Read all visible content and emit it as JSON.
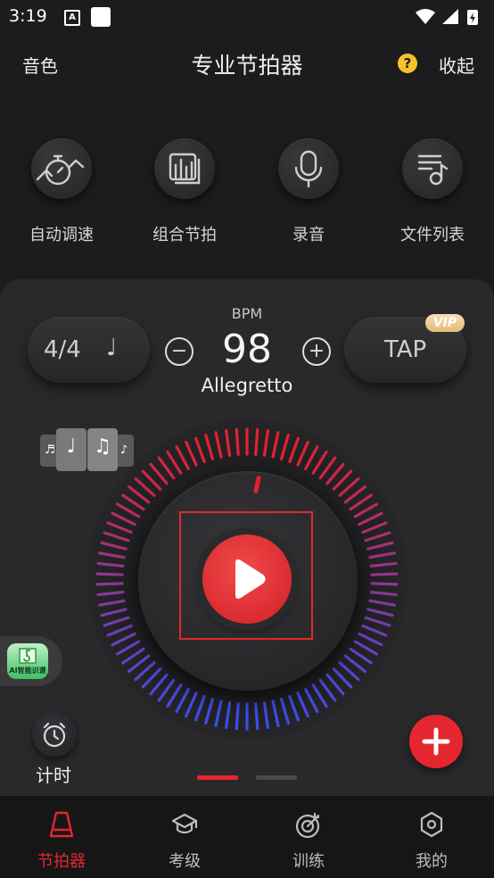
{
  "status_bar": {
    "time": "3:19"
  },
  "top_bar": {
    "left": "音色",
    "title": "专业节拍器",
    "help": "?",
    "right": "收起"
  },
  "tools": [
    {
      "label": "自动调速",
      "icon": "auto-speed-icon"
    },
    {
      "label": "组合节拍",
      "icon": "combo-beat-icon"
    },
    {
      "label": "录音",
      "icon": "microphone-icon"
    },
    {
      "label": "文件列表",
      "icon": "file-list-icon"
    }
  ],
  "metronome": {
    "time_signature": "4/4",
    "note_symbol": "♩",
    "bpm_label": "BPM",
    "bpm": "98",
    "tempo_name": "Allegretto",
    "tap_label": "TAP",
    "vip_label": "VIP",
    "minus": "−",
    "plus": "+"
  },
  "ai_badge": {
    "text": "AI智能识谱"
  },
  "timer": {
    "label": "计时"
  },
  "colors": {
    "accent": "#e5262f",
    "ring_top": "#e5202e",
    "ring_bottom": "#3a4cf0"
  },
  "bottom_nav": [
    {
      "label": "节拍器",
      "icon": "metronome-icon",
      "active": true
    },
    {
      "label": "考级",
      "icon": "graduation-cap-icon",
      "active": false
    },
    {
      "label": "训练",
      "icon": "target-icon",
      "active": false
    },
    {
      "label": "我的",
      "icon": "profile-hexagon-icon",
      "active": false
    }
  ]
}
